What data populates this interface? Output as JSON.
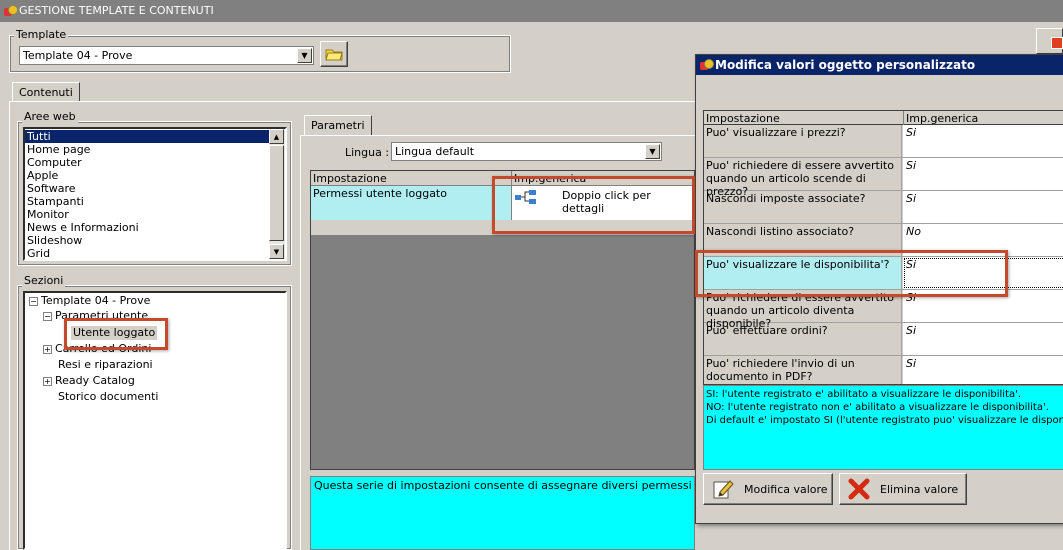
{
  "app": {
    "title": "GESTIONE TEMPLATE E CONTENUTI"
  },
  "template": {
    "label": "Template",
    "selected": "Template 04 - Prove"
  },
  "tabs": {
    "contenuti": "Contenuti",
    "parametri": "Parametri"
  },
  "aree_web": {
    "label": "Aree web",
    "items": [
      "Tutti",
      "Home page",
      "Computer",
      "Apple",
      "Software",
      "Stampanti",
      "Monitor",
      "News e Informazioni",
      "Slideshow",
      "Grid"
    ]
  },
  "sezioni": {
    "label": "Sezioni",
    "root": "Template 04 - Prove",
    "parametri_utente": "Parametri utente",
    "utente_loggato": "Utente loggato",
    "carrello": "Carrello ed Ordini",
    "resi": "Resi e riparazioni",
    "ready": "Ready Catalog",
    "storico": "Storico documenti"
  },
  "parametri": {
    "lingua_label": "Lingua :",
    "lingua_value": "Lingua default",
    "col_impostazione": "Impostazione",
    "col_generica": "Imp.generica",
    "row_name": "Permessi utente loggato",
    "row_value": "Doppio click per dettagli",
    "description": "Questa serie di impostazioni consente di assegnare diversi permessi agli utenti (e"
  },
  "dialog": {
    "title": "Modifica valori oggetto personalizzato",
    "col_impostazione": "Impostazione",
    "col_generica": "Imp.generica",
    "rows": [
      {
        "name": "Puo' visualizzare i prezzi?",
        "value": "Si"
      },
      {
        "name": "Puo' richiedere di essere avvertito quando un articolo scende di prezzo?",
        "value": "Si"
      },
      {
        "name": "Nascondi imposte associate?",
        "value": "Si"
      },
      {
        "name": "Nascondi listino associato?",
        "value": "No"
      },
      {
        "name": "Puo' visualizzare le disponibilita'?",
        "value": "Si"
      },
      {
        "name": "Puo' richiedere di essere avvertito quando un articolo diventa disponibile?",
        "value": "Si"
      },
      {
        "name": "Puo' effettuare ordini?",
        "value": "Si"
      },
      {
        "name": "Puo' richiedere l'invio di un documento in PDF?",
        "value": "Si"
      }
    ],
    "info_lines": [
      "SI: l'utente registrato e' abilitato a visualizzare le disponibilita'.",
      "NO: l'utente registrato non e' abilitato a visualizzare le disponibilita'.",
      "Di default e' impostato SI (l'utente registrato puo' visualizzare le disponibilita')"
    ],
    "btn_modifica": "Modifica valore",
    "btn_elimina": "Elimina valore"
  },
  "colors": {
    "highlight_cyan": "#b0eef2",
    "info_cyan": "#00ffff",
    "annotation_red": "#c44a2d",
    "selection_navy": "#0a246a"
  }
}
